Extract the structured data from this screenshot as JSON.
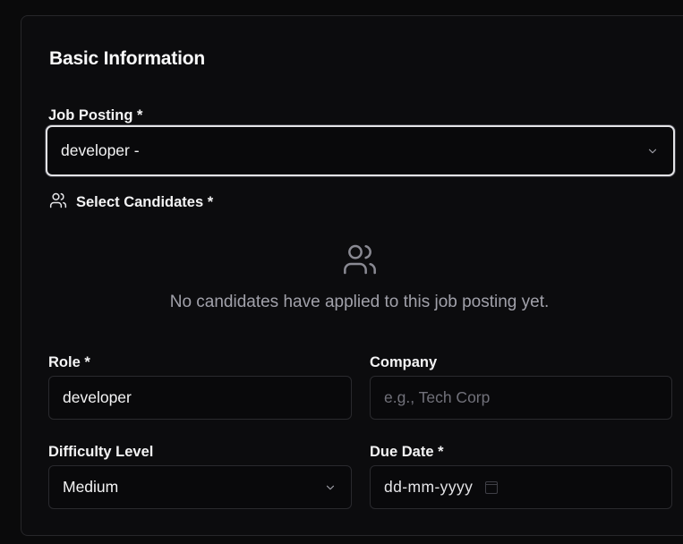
{
  "section": {
    "title": "Basic Information"
  },
  "job_posting": {
    "label": "Job Posting *",
    "value": "developer -",
    "icon": "chevron-down-icon"
  },
  "candidates": {
    "label": "Select Candidates *",
    "icon": "users-icon",
    "empty_icon": "users-icon",
    "empty_message": "No candidates have applied to this job posting yet."
  },
  "role": {
    "label": "Role *",
    "value": "developer"
  },
  "company": {
    "label": "Company",
    "placeholder": "e.g., Tech Corp"
  },
  "difficulty": {
    "label": "Difficulty Level",
    "value": "Medium",
    "icon": "chevron-down-icon"
  },
  "due_date": {
    "label": "Due Date *",
    "placeholder": "dd-mm-yyyy",
    "icon": "calendar-icon"
  },
  "colors": {
    "background": "#0a0a0b",
    "border": "#27272a",
    "focus_ring": "#e4e4e7",
    "muted_text": "#a1a1aa",
    "placeholder_text": "#71717a"
  }
}
